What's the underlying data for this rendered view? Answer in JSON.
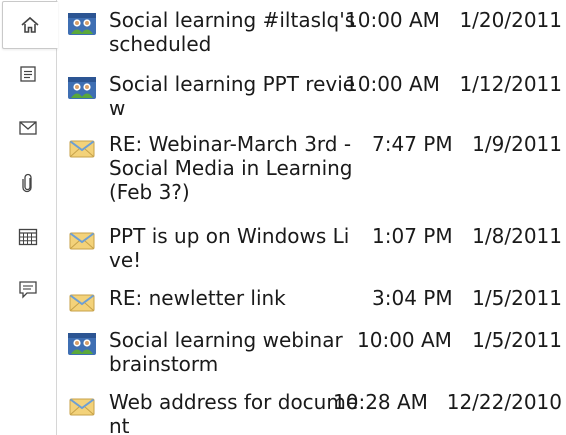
{
  "sidebar": {
    "buttons": [
      {
        "name": "home-icon"
      },
      {
        "name": "details-icon"
      },
      {
        "name": "mail-icon"
      },
      {
        "name": "attachment-icon"
      },
      {
        "name": "calendar-icon"
      },
      {
        "name": "comment-icon"
      }
    ]
  },
  "items": [
    {
      "type": "meeting",
      "subject": "Social learning #iltaslq's scheduled",
      "time": "10:00 AM",
      "date": "1/20/2011"
    },
    {
      "type": "meeting",
      "subject": "Social learning PPT review",
      "time": "10:00 AM",
      "date": "1/12/2011"
    },
    {
      "type": "mail",
      "subject": "RE: Webinar-March 3rd - Social Media in Learning (Feb 3?)",
      "time": "7:47 PM",
      "date": "1/9/2011"
    },
    {
      "type": "mail",
      "subject": "PPT is up on Windows Live!",
      "time": "1:07 PM",
      "date": "1/8/2011"
    },
    {
      "type": "mail",
      "subject": "RE: newletter link",
      "time": "3:04 PM",
      "date": "1/5/2011"
    },
    {
      "type": "meeting",
      "subject": "Social learning webinar brainstorm",
      "time": "10:00 AM",
      "date": "1/5/2011"
    },
    {
      "type": "mail",
      "subject": "Web address for document",
      "time": "10:28 AM",
      "date": "12/22/2010"
    }
  ],
  "colors": {
    "meeting_blue": "#3f6fb3",
    "meeting_green": "#5aa83a",
    "mail_yellow": "#f3d27a",
    "mail_blue": "#6d9fd4",
    "sidebar_icon": "#444444"
  }
}
